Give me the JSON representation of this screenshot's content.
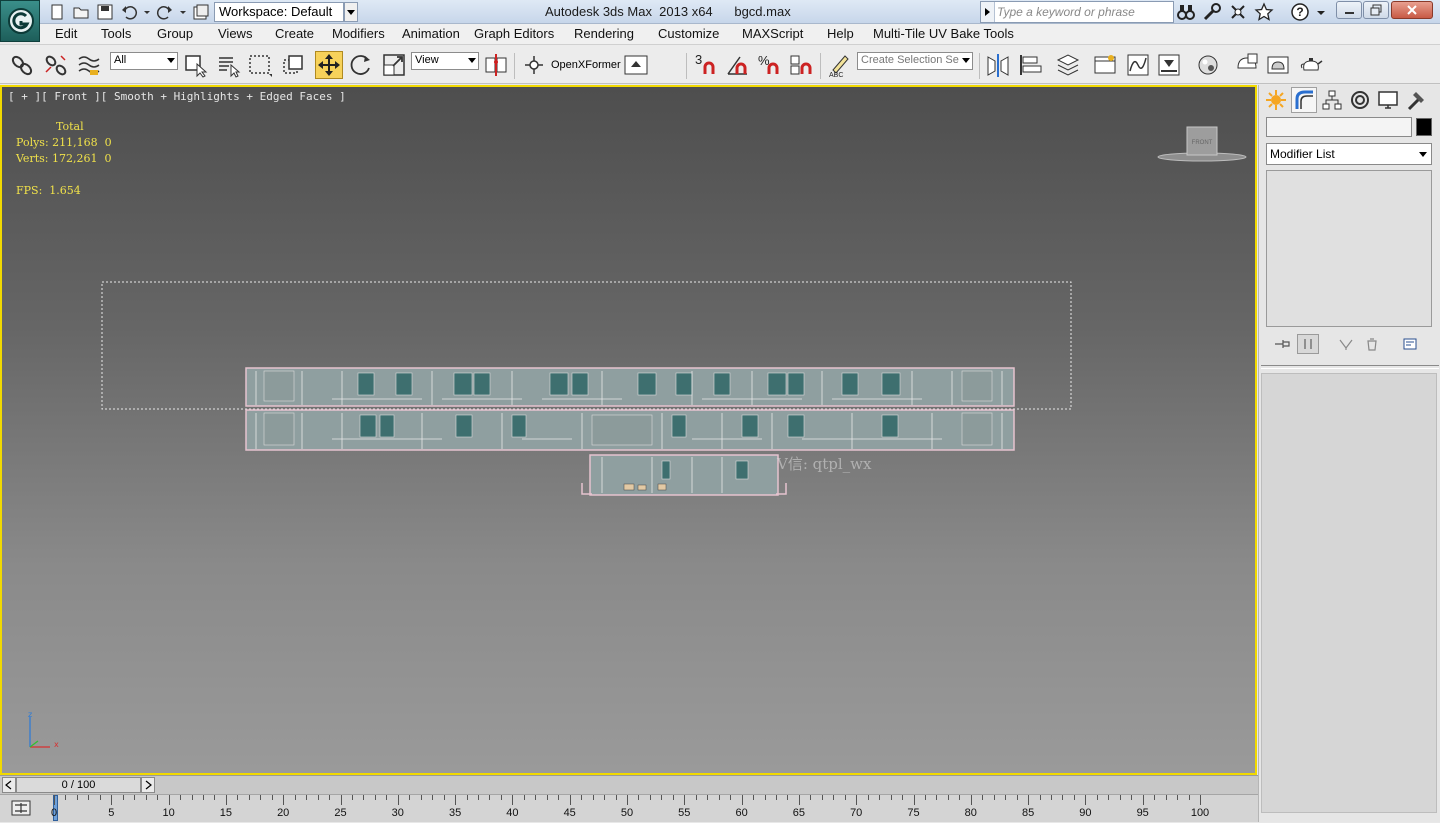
{
  "titlebar": {
    "workspace_label": "Workspace: Default",
    "app_title": "Autodesk 3ds Max  2013 x64",
    "file_name": "bgcd.max",
    "search_placeholder": "Type a keyword or phrase"
  },
  "menu": [
    "Edit",
    "Tools",
    "Group",
    "Views",
    "Create",
    "Modifiers",
    "Animation",
    "Graph Editors",
    "Rendering",
    "Customize",
    "MAXScript",
    "Help",
    "Multi-Tile UV Bake Tools"
  ],
  "toolbar": {
    "selection_filter": "All",
    "reference_coord": "View",
    "openxformer_label": "OpenXFormer",
    "snap_label": "3",
    "named_selection_placeholder": "Create Selection Se"
  },
  "viewport": {
    "label": "[ + ][ Front ][ Smooth + Highlights + Edged Faces ]",
    "stats": {
      "header": "Total",
      "polys_label": "Polys:",
      "polys_value": "211,168",
      "polys_sel": "0",
      "verts_label": "Verts:",
      "verts_value": "172,261",
      "verts_sel": "0",
      "fps_label": "FPS:",
      "fps_value": "1.654"
    },
    "watermark": "V信: qtpl_wx",
    "viewcube_face": "FRONT",
    "axis_z": "z",
    "axis_x": "x"
  },
  "command_panel": {
    "name_value": "",
    "modifier_list": "Modifier List"
  },
  "timeline": {
    "slider_text": "0 / 100",
    "ticks": [
      "0",
      "5",
      "10",
      "15",
      "20",
      "25",
      "30",
      "35",
      "40",
      "45",
      "50",
      "55",
      "60",
      "65",
      "70",
      "75",
      "80",
      "85",
      "90",
      "95",
      "100"
    ]
  }
}
